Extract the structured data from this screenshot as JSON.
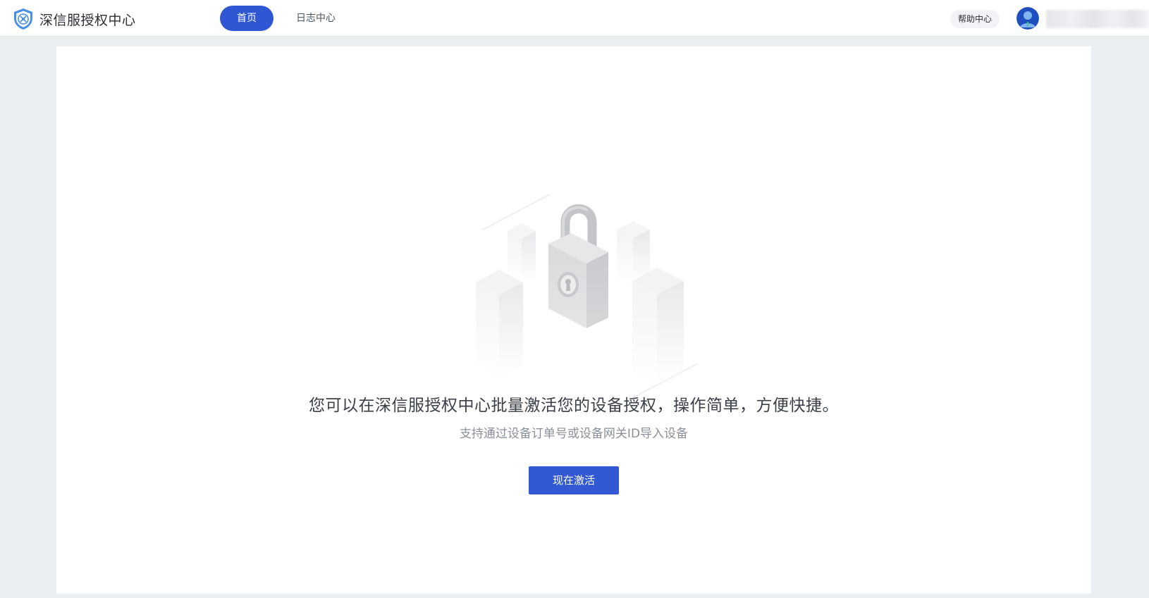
{
  "header": {
    "brand_title": "深信服授权中心",
    "nav_tabs": [
      {
        "label": "首页",
        "active": true
      },
      {
        "label": "日志中心",
        "active": false
      }
    ],
    "help_label": "帮助中心",
    "user_name": "",
    "icons": {
      "logo": "shield-logo-icon",
      "avatar": "user-avatar-icon"
    }
  },
  "main": {
    "headline": "您可以在深信服授权中心批量激活您的设备授权，操作简单，方便快捷。",
    "subline": "支持通过设备订单号或设备网关ID导入设备",
    "activate_label": "现在激活",
    "illustration": "padlock-isometric-illustration"
  },
  "colors": {
    "accent": "#2f57d4",
    "button": "#3358d4",
    "page_bg": "#ebeef2",
    "card_bg": "#ffffff"
  }
}
